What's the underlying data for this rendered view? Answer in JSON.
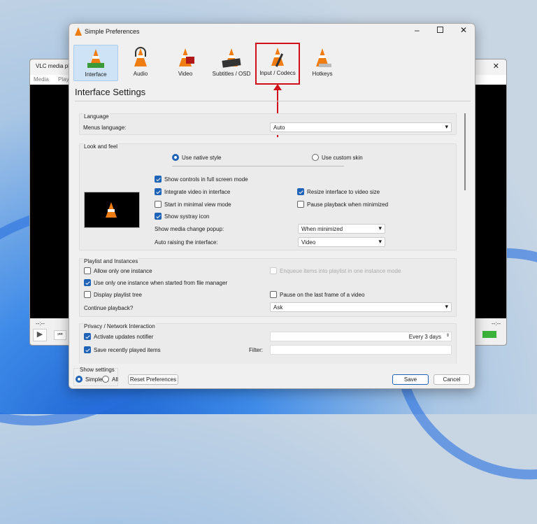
{
  "background_window": {
    "title": "VLC media player",
    "menu": [
      "Media",
      "Playback"
    ],
    "time_left": "--:--",
    "time_right": "--:--"
  },
  "dialog": {
    "title": "Simple Preferences",
    "categories": [
      {
        "label": "Interface",
        "active": true
      },
      {
        "label": "Audio"
      },
      {
        "label": "Video"
      },
      {
        "label": "Subtitles / OSD"
      },
      {
        "label": "Input / Codecs",
        "highlighted": true
      },
      {
        "label": "Hotkeys"
      }
    ],
    "heading": "Interface Settings",
    "language": {
      "title": "Language",
      "menus_language_label": "Menus language:",
      "menus_language_value": "Auto"
    },
    "look": {
      "title": "Look and feel",
      "native": "Use native style",
      "custom": "Use custom skin",
      "opts": [
        {
          "label": "Show controls in full screen mode",
          "checked": true
        },
        {
          "label": "Integrate video in interface",
          "checked": true
        },
        {
          "label": "Resize interface to video size",
          "checked": true
        },
        {
          "label": "Start in minimal view mode",
          "checked": false
        },
        {
          "label": "Pause playback when minimized",
          "checked": false
        },
        {
          "label": "Show systray icon",
          "checked": true
        }
      ],
      "popup_label": "Show media change popup:",
      "popup_value": "When minimized",
      "raise_label": "Auto raising the interface:",
      "raise_value": "Video"
    },
    "playlist": {
      "title": "Playlist and Instances",
      "opts": [
        {
          "label": "Allow only one instance",
          "checked": false
        },
        {
          "label": "Enqueue items into playlist in one instance mode",
          "checked": false,
          "disabled": true
        },
        {
          "label": "Use only one instance when started from file manager",
          "checked": true
        },
        {
          "label": "Display playlist tree",
          "checked": false
        },
        {
          "label": "Pause on the last frame of a video",
          "checked": false
        }
      ],
      "continue_label": "Continue playback?",
      "continue_value": "Ask"
    },
    "privacy": {
      "title": "Privacy / Network Interaction",
      "updates": "Activate updates notifier",
      "updates_value": "Every 3 days",
      "recent": "Save recently played items",
      "filter_label": "Filter:",
      "filter_value": ""
    },
    "show_settings": {
      "title": "Show settings",
      "simple": "Simple",
      "all": "All"
    },
    "reset": "Reset Preferences",
    "save": "Save",
    "cancel": "Cancel"
  },
  "colors": {
    "accent": "#1f63b8",
    "highlight": "#d0101a"
  }
}
